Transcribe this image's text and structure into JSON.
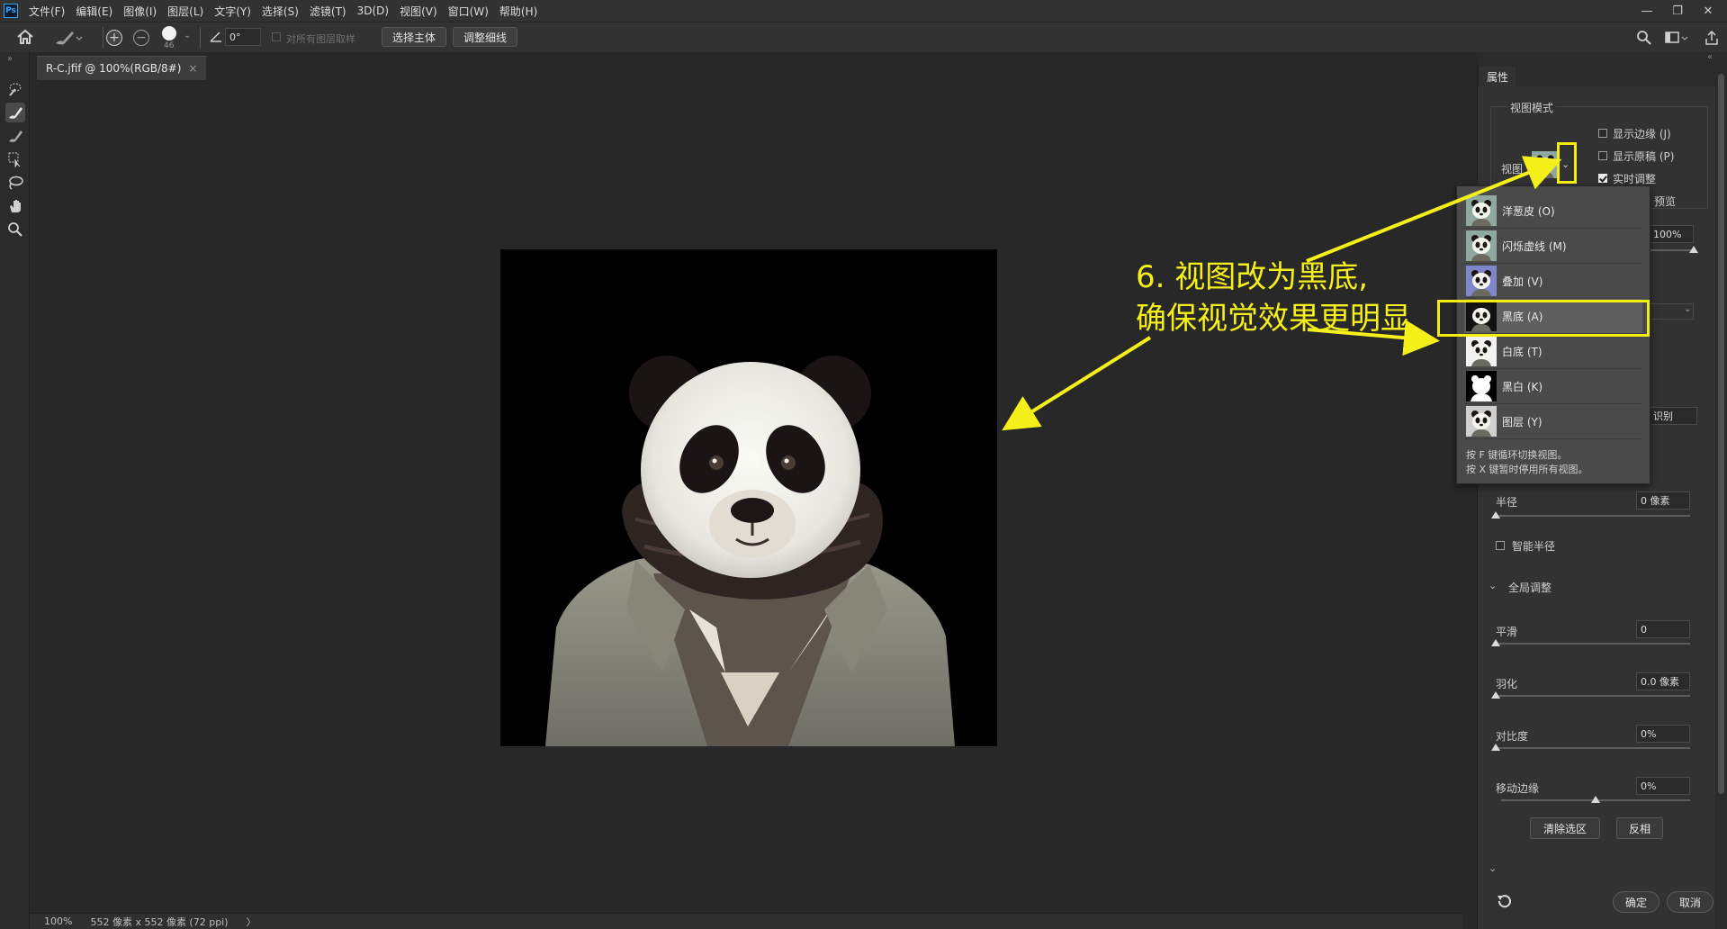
{
  "app": {
    "logo": "Ps",
    "menu": [
      "文件(F)",
      "编辑(E)",
      "图像(I)",
      "图层(L)",
      "文字(Y)",
      "选择(S)",
      "滤镜(T)",
      "3D(D)",
      "视图(V)",
      "窗口(W)",
      "帮助(H)"
    ],
    "window_controls": [
      "—",
      "❐",
      "✕"
    ]
  },
  "options_bar": {
    "brush_size": "46",
    "angle": "0°",
    "sample_all_layers": "对所有图层取样",
    "select_subject": "选择主体",
    "refine_hair": "调整细线"
  },
  "document": {
    "tab_title": "R-C.jfif @ 100%(RGB/8#)",
    "tab_close": "×",
    "zoom": "100%",
    "size_info": "552 像素 x 552 像素 (72 ppi)",
    "status_arrow": "〉"
  },
  "panel": {
    "tab": "属性",
    "view_mode_title": "视图模式",
    "view_label": "视图",
    "show_edge": "显示边缘 (J)",
    "show_original": "显示原稿 (P)",
    "realtime": "实时调整",
    "preview_partial": "预览",
    "opacity": "100%",
    "recognize": "识别",
    "radius_label": "半径",
    "radius_value": "0 像素",
    "smart_radius": "智能半径",
    "global_title": "全局调整",
    "smooth_label": "平滑",
    "smooth_value": "0",
    "feather_label": "羽化",
    "feather_value": "0.0 像素",
    "contrast_label": "对比度",
    "contrast_value": "0%",
    "shift_edge_label": "移动边缘",
    "shift_edge_value": "0%",
    "clear_selection": "清除选区",
    "invert": "反相",
    "ok": "确定",
    "cancel": "取消",
    "realtime_checked": true
  },
  "view_dropdown": {
    "items": [
      {
        "label": "洋葱皮 (O)",
        "bg": "#8fa9a0"
      },
      {
        "label": "闪烁虚线 (M)",
        "bg": "#8fa9a0"
      },
      {
        "label": "叠加 (V)",
        "bg": "#7f86c9"
      },
      {
        "label": "黑底 (A)",
        "bg": "#111111"
      },
      {
        "label": "白底 (T)",
        "bg": "#f2f2f2"
      },
      {
        "label": "黑白 (K)",
        "bg": "#000000"
      },
      {
        "label": "图层 (Y)",
        "bg": "#cfcfcf"
      }
    ],
    "selected_index": 3,
    "hint1": "按 F 键循环切换视图。",
    "hint2": "按 X 键暂时停用所有视图。"
  },
  "annotation": {
    "line1": "6. 视图改为黑底,",
    "line2": "确保视觉效果更明显",
    "color": "#f5ef1a"
  }
}
